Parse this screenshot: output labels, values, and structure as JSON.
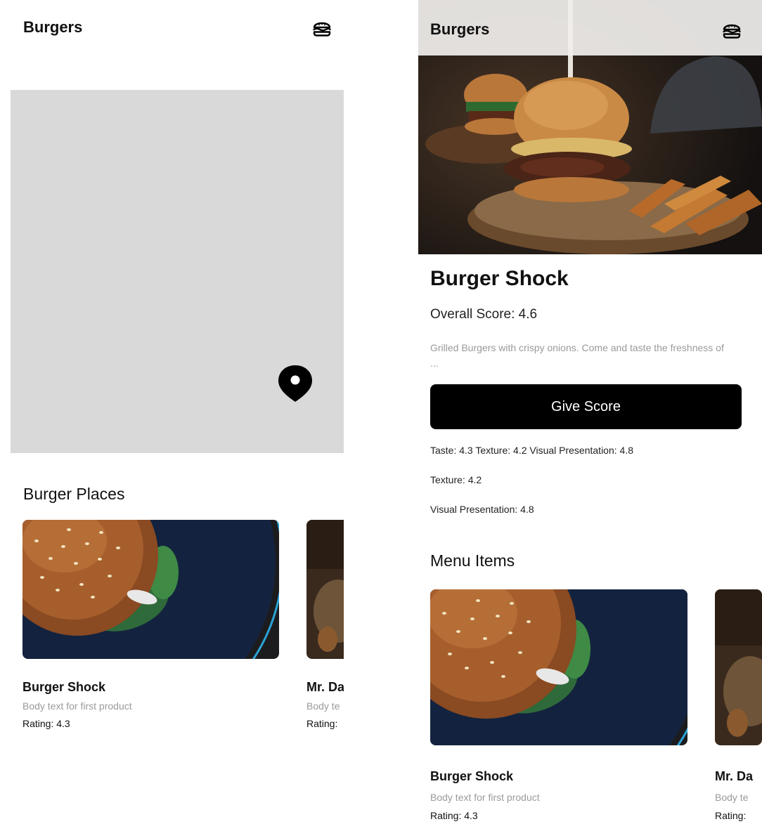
{
  "left_screen": {
    "app_title": "Burgers",
    "section_heading": "Burger Places",
    "cards": [
      {
        "title": "Burger Shock",
        "body": "Body text for first product",
        "rating": "Rating: 4.3"
      },
      {
        "title": "Mr. Da",
        "body": "Body te",
        "rating": "Rating:"
      }
    ]
  },
  "right_screen": {
    "app_title": "Burgers",
    "restaurant": {
      "name": "Burger Shock",
      "overall_score": "Overall Score: 4.6",
      "description": "Grilled Burgers with crispy onions. Come and taste the freshness of ...",
      "give_score_label": "Give Score",
      "scores_line": "Taste: 4.3  Texture: 4.2  Visual Presentation: 4.8",
      "texture_line": "Texture: 4.2",
      "visual_line": "Visual Presentation: 4.8"
    },
    "section_heading": "Menu Items",
    "cards": [
      {
        "title": "Burger Shock",
        "body": "Body text for first product",
        "rating": "Rating: 4.3"
      },
      {
        "title": "Mr. Da",
        "body": "Body te",
        "rating": "Rating:"
      }
    ]
  },
  "icons": {
    "app_icon": "hamburger-icon",
    "map_marker": "map-pin-icon"
  },
  "colors": {
    "primary": "#000000",
    "map_placeholder": "#d9d9d9",
    "muted_text": "#9a9a9a"
  }
}
